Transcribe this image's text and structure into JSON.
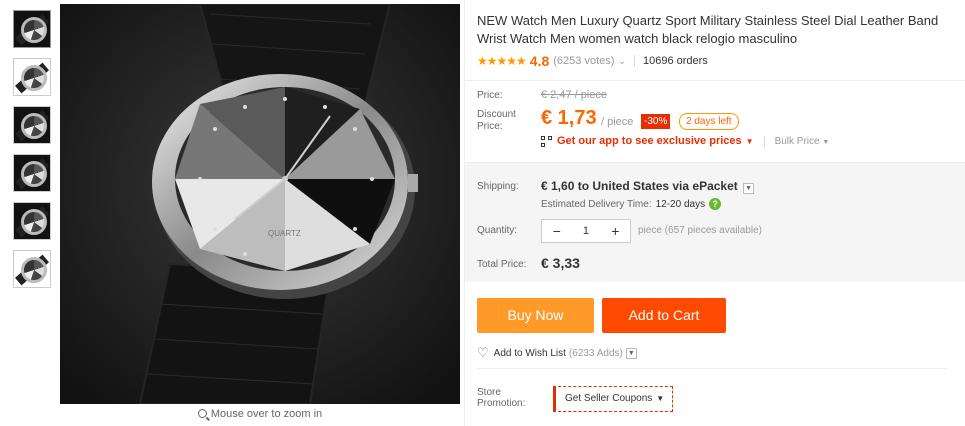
{
  "gallery": {
    "thumbnails": [
      "thumb-1",
      "thumb-2",
      "thumb-3",
      "thumb-4",
      "thumb-5",
      "thumb-6"
    ],
    "dial_text": "QUARTZ",
    "zoom_hint": "Mouse over to zoom in"
  },
  "product": {
    "title": "NEW Watch Men Luxury Quartz Sport Military Stainless Steel Dial Leather Band Wrist Watch Men women watch black relogio masculino",
    "rating": {
      "stars": "★★★★★",
      "score": "4.8",
      "votes": "(6253 votes)",
      "orders": "10696 orders"
    }
  },
  "pricing": {
    "price_label": "Price:",
    "original_price": "€ 2,47 / piece",
    "discount_label_1": "Discount",
    "discount_label_2": "Price:",
    "current_price": "€ 1,73",
    "per_unit": "/ piece",
    "discount_badge": "-30%",
    "time_left": "2 days left",
    "app_promo": "Get our app to see exclusive prices",
    "bulk_price": "Bulk Price"
  },
  "shipping": {
    "label": "Shipping:",
    "value": "€ 1,60 to United States via ePacket",
    "delivery_label": "Estimated Delivery Time:",
    "delivery_value": "12-20 days",
    "quantity_label": "Quantity:",
    "quantity_value": "1",
    "availability": "piece (657 pieces available)",
    "total_label": "Total Price:",
    "total_value": "€ 3,33"
  },
  "actions": {
    "buy_now": "Buy Now",
    "add_to_cart": "Add to Cart",
    "wish_list": "Add to Wish List",
    "wish_count": "(6233 Adds)",
    "store_promo_1": "Store",
    "store_promo_2": "Promotion:",
    "coupons": "Get Seller Coupons"
  },
  "colors": {
    "accent": "#ff6600",
    "buy_now": "#ff9a29",
    "add_to_cart": "#ff4a00",
    "discount_red": "#e62e04",
    "star": "#ff9900"
  }
}
